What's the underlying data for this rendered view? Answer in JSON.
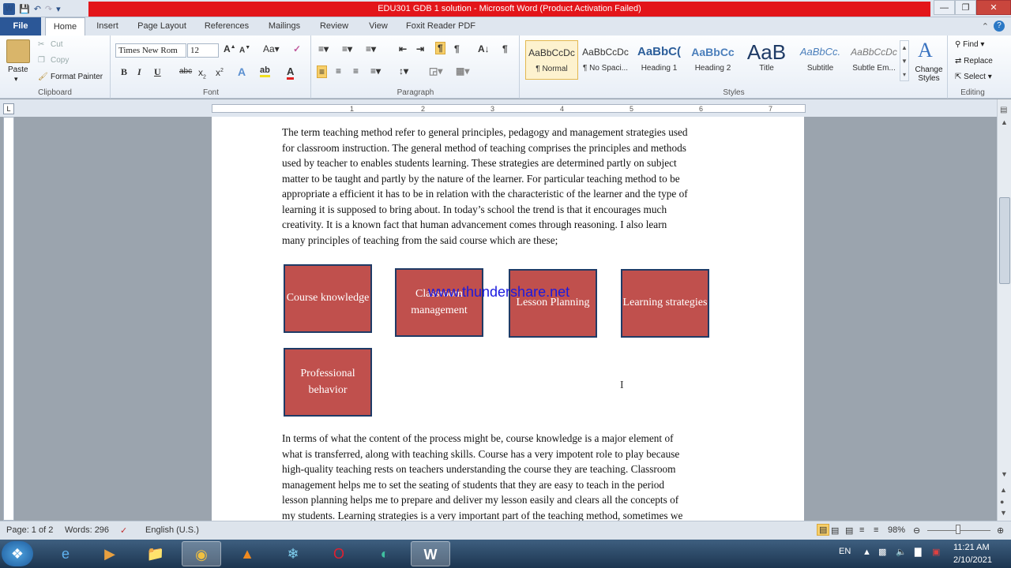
{
  "window": {
    "title": "EDU301 GDB 1 solution  -  Microsoft Word (Product Activation Failed)"
  },
  "ribbon_tabs": [
    "File",
    "Home",
    "Insert",
    "Page Layout",
    "References",
    "Mailings",
    "Review",
    "View",
    "Foxit Reader PDF"
  ],
  "clipboard": {
    "paste": "Paste",
    "cut": "Cut",
    "copy": "Copy",
    "format_painter": "Format Painter",
    "label": "Clipboard"
  },
  "font": {
    "name": "Times New Rom",
    "size": "12",
    "label": "Font"
  },
  "paragraph": {
    "label": "Paragraph"
  },
  "styles": {
    "label": "Styles",
    "items": [
      {
        "preview": "AaBbCcDc",
        "name": "¶ Normal"
      },
      {
        "preview": "AaBbCcDc",
        "name": "¶ No Spaci..."
      },
      {
        "preview": "AaBbC(",
        "name": "Heading 1"
      },
      {
        "preview": "AaBbCc",
        "name": "Heading 2"
      },
      {
        "preview": "AaB",
        "name": "Title"
      },
      {
        "preview": "AaBbCc.",
        "name": "Subtitle"
      },
      {
        "preview": "AaBbCcDc",
        "name": "Subtle Em..."
      }
    ],
    "change_styles": "Change Styles"
  },
  "editing": {
    "find": "Find",
    "replace": "Replace",
    "select": "Select",
    "label": "Editing"
  },
  "document": {
    "para1_lines": [
      "The term teaching method refer to general principles, pedagogy and management strategies used",
      "for classroom instruction. The general method of teaching comprises the principles and methods",
      "used by teacher to enables students learning.  These strategies are determined partly on subject",
      "matter to be taught and partly by the nature of the learner. For particular teaching method to be",
      "appropriate a efficient it has to be in relation with the characteristic of the learner and the type of",
      "learning it is supposed to bring about. In today’s school the trend is that it encourages much",
      "creativity. It is a known fact that human advancement comes through reasoning. I also learn",
      "many principles of teaching from the said course which are these;"
    ],
    "boxes": [
      "Course knowledge",
      "Classroom management",
      "Lesson Planning",
      "Learning strategies",
      "Professional behavior"
    ],
    "watermark": "www.thundershare.net",
    "para2_lines": [
      "In terms of what the content of the process might be, course knowledge is a major element of",
      "what is transferred, along with teaching skills. Course has a very impotent role to play because",
      "high-quality teaching rests on teachers understanding the course they are teaching. Classroom",
      "management helps me to set the seating of students that they are easy to teach in the period",
      "lesson planning helps me to prepare and deliver my lesson easily and clears all  the concepts of",
      "my students. Learning strategies is a very important part of the teaching method, sometimes we"
    ]
  },
  "status": {
    "page": "Page: 1 of 2",
    "words": "Words: 296",
    "language": "English (U.S.)",
    "zoom": "98%"
  },
  "tray": {
    "lang": "EN",
    "time": "11:21 AM",
    "date": "2/10/2021"
  }
}
